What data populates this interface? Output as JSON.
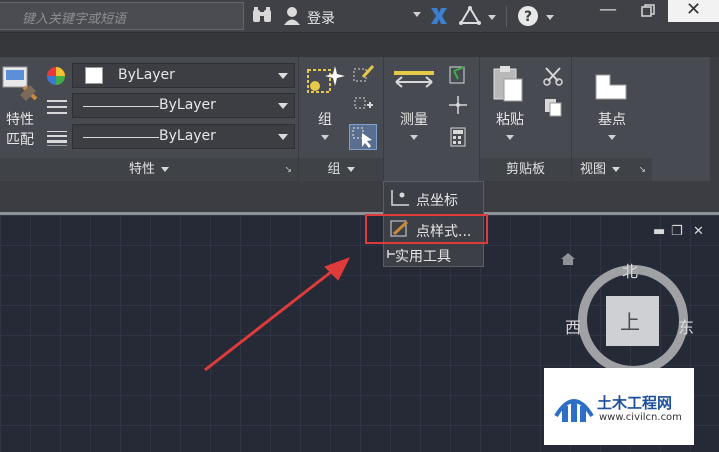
{
  "titlebar": {
    "search_placeholder": "键入关键字或短语",
    "login_label": "登录",
    "help_icon": "?",
    "minimize": "—",
    "close": "✕"
  },
  "ribbon": {
    "properties_panel": {
      "title": "特性",
      "match_label_1": "特性",
      "match_label_2": "匹配",
      "color_value": "ByLayer",
      "linetype_value": "ByLayer",
      "lineweight_value": "ByLayer"
    },
    "group_panel": {
      "title": "组",
      "group_label": "组"
    },
    "utilities_panel": {
      "measure_label": "测量"
    },
    "clipboard_panel": {
      "title": "剪贴板",
      "paste_label": "粘贴"
    },
    "view_panel": {
      "title": "视图",
      "base_label": "基点"
    }
  },
  "dropdown_menu": {
    "items": [
      {
        "label": "点坐标",
        "icon": "point-coordinate-icon"
      },
      {
        "label": "点样式...",
        "icon": "point-style-icon"
      }
    ],
    "footer": "实用工具"
  },
  "viewcube": {
    "north": "北",
    "west": "西",
    "east": "东",
    "face": "上"
  },
  "watermark": {
    "title": "土木工程网",
    "url": "www.civilcn.com"
  },
  "colors": {
    "highlight": "#e03b3b",
    "arrow": "#e03b3b",
    "canvas_bg": "#252a36"
  }
}
